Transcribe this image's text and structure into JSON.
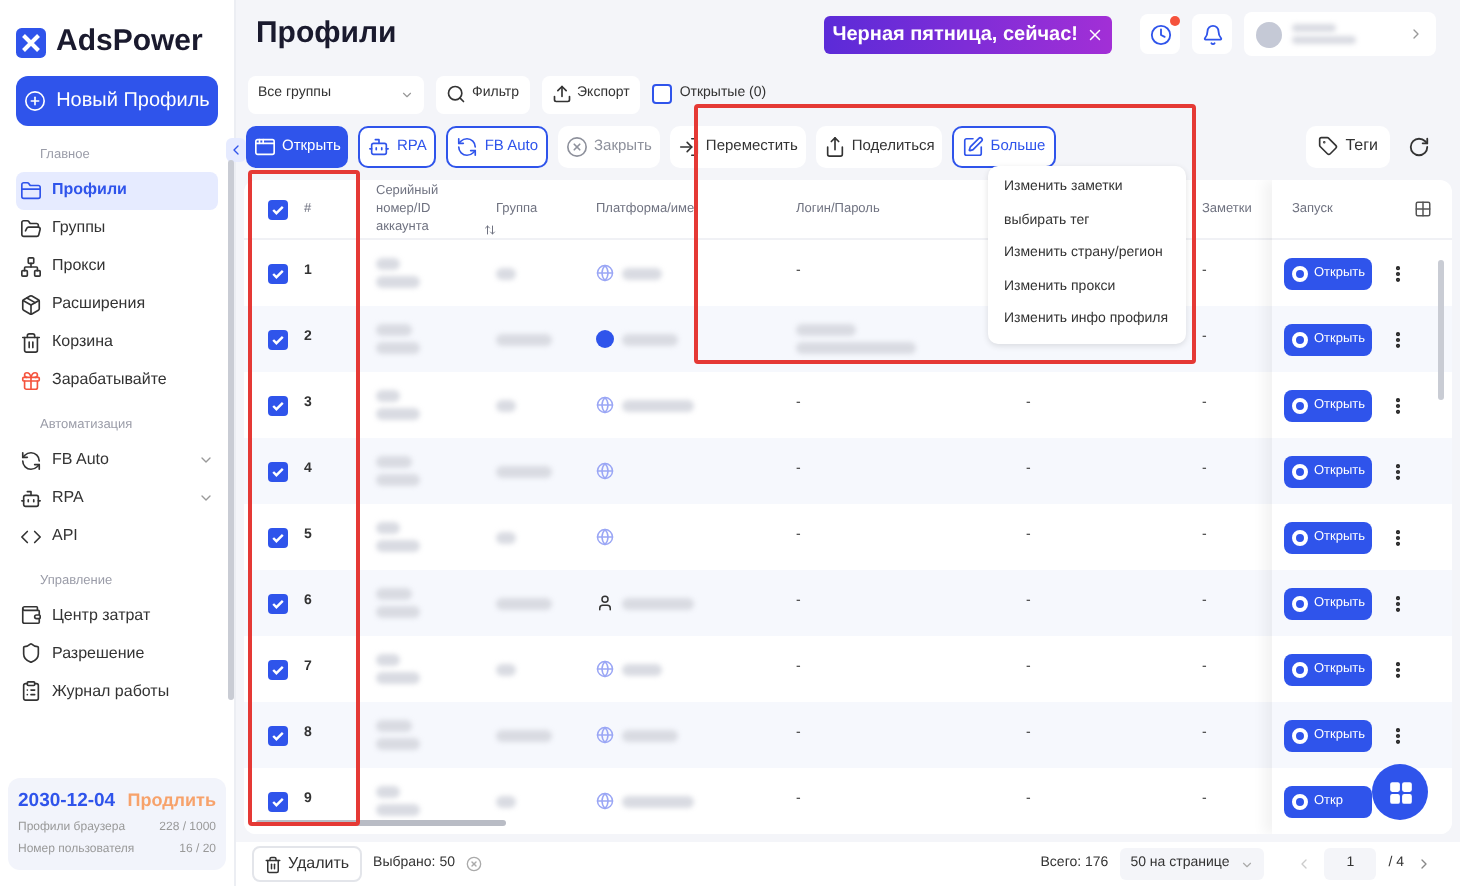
{
  "app": {
    "name": "AdsPower"
  },
  "sidebar": {
    "new_button": "Новый Профиль",
    "sections": [
      {
        "title": "Главное",
        "items": [
          {
            "label": "Профили",
            "selected": true,
            "expandable": false
          },
          {
            "label": "Группы",
            "selected": false,
            "expandable": false
          },
          {
            "label": "Прокси",
            "selected": false,
            "expandable": false
          },
          {
            "label": "Расширения",
            "selected": false,
            "expandable": false
          },
          {
            "label": "Корзина",
            "selected": false,
            "expandable": false
          },
          {
            "label": "Зарабатывайте",
            "selected": false,
            "expandable": false
          }
        ]
      },
      {
        "title": "Автоматизация",
        "items": [
          {
            "label": "FB Auto",
            "selected": false,
            "expandable": true
          },
          {
            "label": "RPA",
            "selected": false,
            "expandable": true
          },
          {
            "label": "API",
            "selected": false,
            "expandable": false
          }
        ]
      },
      {
        "title": "Управление",
        "items": [
          {
            "label": "Центр затрат",
            "selected": false,
            "expandable": false
          },
          {
            "label": "Разрешение",
            "selected": false,
            "expandable": false
          },
          {
            "label": "Журнал работы",
            "selected": false,
            "expandable": false
          }
        ]
      }
    ],
    "plan": {
      "date": "2030-12-04",
      "renew": "Продлить",
      "stats": [
        {
          "label": "Профили браузера",
          "value": "228 / 1000"
        },
        {
          "label": "Номер пользователя",
          "value": "16 / 20"
        }
      ]
    }
  },
  "header": {
    "title": "Профили",
    "promo": "Черная пятница, сейчас!"
  },
  "filters": {
    "group_select": "Все группы",
    "filter": "Фильтр",
    "export": "Экспорт",
    "opened": {
      "label": "Открытые (0)",
      "checked": false
    }
  },
  "actions": [
    {
      "label": "Открыть",
      "kind": "primary"
    },
    {
      "label": "RPA",
      "kind": "outline"
    },
    {
      "label": "FB Auto",
      "kind": "outline"
    },
    {
      "label": "Закрыть",
      "kind": "disabled"
    },
    {
      "label": "Переместить",
      "kind": "plain"
    },
    {
      "label": "Поделиться",
      "kind": "plain"
    },
    {
      "label": "Больше",
      "kind": "outline"
    }
  ],
  "tags_button": "Теги",
  "more_menu": [
    "Изменить заметки",
    "выбирать тег",
    "Изменить страну/регион",
    "Изменить прокси",
    "Изменить инфо профиля"
  ],
  "table": {
    "columns": [
      "#",
      "Серийный номер/ID аккаунта",
      "Группа",
      "Платформа/име",
      "Логин/Пароль",
      "Заметки",
      "Запуск"
    ],
    "all_checked": true,
    "rows": [
      {
        "num": "1",
        "checked": true,
        "kind": "globe",
        "login": "-",
        "notes": "-",
        "launch": "Открыть"
      },
      {
        "num": "2",
        "checked": true,
        "kind": "dot",
        "notes": "-",
        "launch": "Открыть"
      },
      {
        "num": "3",
        "checked": true,
        "kind": "globe",
        "login": "-",
        "column_6": "-",
        "notes": "-",
        "launch": "Открыть"
      },
      {
        "num": "4",
        "checked": true,
        "kind": "globe",
        "login": "-",
        "column_6": "-",
        "notes": "-",
        "launch": "Открыть"
      },
      {
        "num": "5",
        "checked": true,
        "kind": "globe",
        "login": "-",
        "column_6": "-",
        "notes": "-",
        "launch": "Открыть"
      },
      {
        "num": "6",
        "checked": true,
        "kind": "figure",
        "login": "-",
        "column_6": "-",
        "notes": "-",
        "launch": "Открыть"
      },
      {
        "num": "7",
        "checked": true,
        "kind": "globe",
        "login": "-",
        "column_6": "-",
        "notes": "-",
        "launch": "Открыть"
      },
      {
        "num": "8",
        "checked": true,
        "kind": "globe",
        "login": "-",
        "column_6": "-",
        "notes": "-",
        "launch": "Открыть"
      },
      {
        "num": "9",
        "checked": true,
        "kind": "globe",
        "login": "-",
        "column_6": "-",
        "notes": "-",
        "launch": "Откр"
      }
    ]
  },
  "footer": {
    "delete": "Удалить",
    "selected": "Выбрано: 50",
    "total": "Всего: 176",
    "per_page": "50 на странице",
    "page": "1",
    "pages": "/ 4"
  }
}
